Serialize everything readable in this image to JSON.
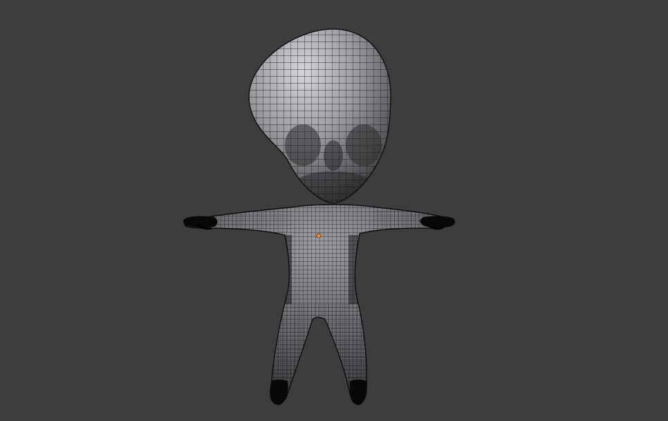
{
  "viewport": {
    "background_color": "#3d3d3d",
    "view_mode": "wireframe-on-shaded",
    "mesh": {
      "object_type": "chibi-character",
      "pose": "T-pose",
      "shading_color_light": "#c9c9cf",
      "shading_color_dark": "#1c1c1e",
      "wire_color": "#000000",
      "origin_color": "#f08a2a"
    }
  }
}
